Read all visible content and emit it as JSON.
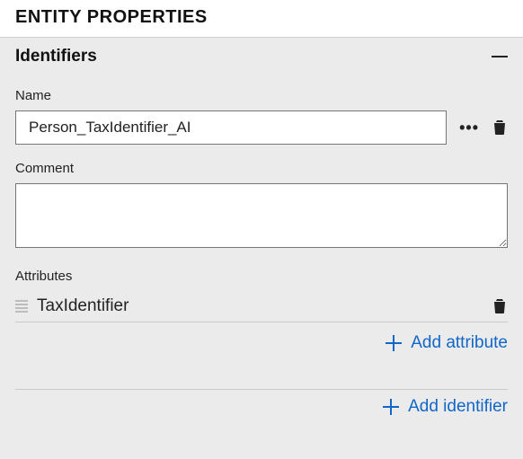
{
  "header": {
    "title": "ENTITY PROPERTIES"
  },
  "section": {
    "title": "Identifiers"
  },
  "labels": {
    "name": "Name",
    "comment": "Comment",
    "attributes": "Attributes"
  },
  "form": {
    "name_value": "Person_TaxIdentifier_AI",
    "comment_value": ""
  },
  "attributes": [
    {
      "name": "TaxIdentifier"
    }
  ],
  "actions": {
    "add_attribute": "Add attribute",
    "add_identifier": "Add identifier"
  }
}
